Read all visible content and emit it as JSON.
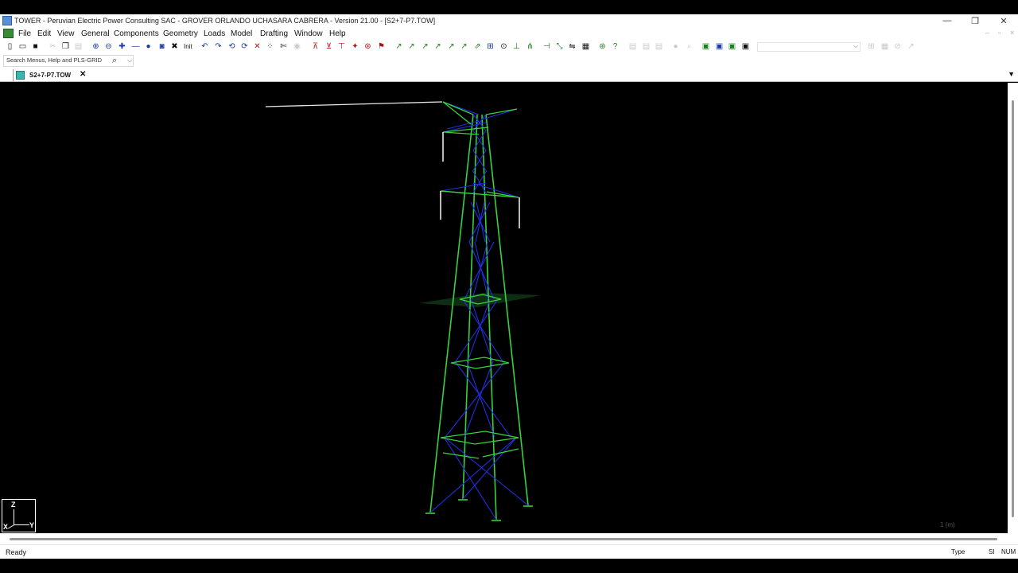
{
  "window": {
    "title": "TOWER - Peruvian Electric Power Consulting SAC - GROVER ORLANDO UCHASARA CABRERA - Version 21.00 - [S2+7-P7.TOW]",
    "controls": {
      "minimize": "—",
      "restore": "❐",
      "close": "✕"
    }
  },
  "menu": {
    "items": [
      "File",
      "Edit",
      "View",
      "General",
      "Components",
      "Geometry",
      "Loads",
      "Model",
      "Drafting",
      "Window",
      "Help"
    ],
    "mdi_controls": {
      "minimize": "–",
      "restore": "▫",
      "close": "×"
    }
  },
  "toolbar": {
    "init_label": "Init",
    "combo_value": ""
  },
  "search": {
    "placeholder": "Search Menus, Help and PLS-GRID",
    "icon": "search-icon"
  },
  "document_tab": {
    "label": "S2+7-P7.TOW",
    "close_glyph": "✕",
    "overflow_glyph": "▼"
  },
  "viewport": {
    "background": "#000000",
    "colors": {
      "legs": "#39d13a",
      "bracing": "#1f2fe6",
      "wire": "#e8e8e8",
      "ground_plane": "#123a18"
    },
    "axes": {
      "z": "Z",
      "x": "X",
      "y": "Y"
    },
    "scale_readout": "1 (m)"
  },
  "status_bar": {
    "status": "Ready",
    "type": "Type",
    "unit": "SI",
    "num": "NUM"
  }
}
